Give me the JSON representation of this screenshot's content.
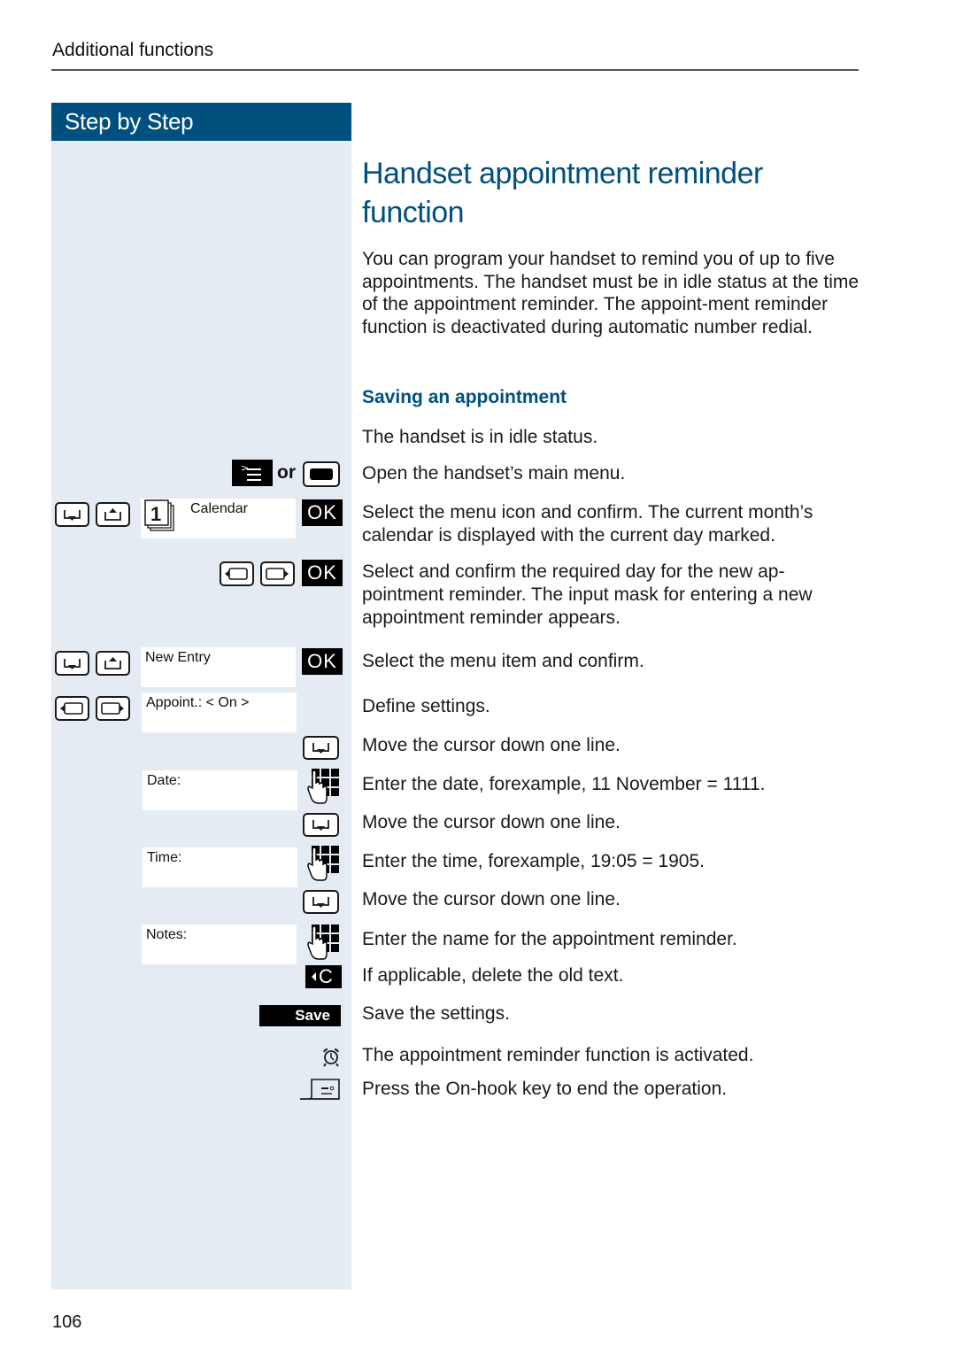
{
  "header": {
    "section": "Additional functions",
    "page_number": "106"
  },
  "sidebar": {
    "title": "Step by Step",
    "or_label": "or",
    "displays": {
      "calendar": "Calendar",
      "calendar_icon_digit": "1",
      "new_entry": "New Entry",
      "appoint": "Appoint.: < On >",
      "date": "Date:",
      "time": "Time:",
      "notes": "Notes:"
    },
    "ok_label": "OK",
    "clear_label": "C",
    "save_label": "Save"
  },
  "main": {
    "title": "Handset appointment reminder function",
    "intro": "You can program your handset to remind you of up to five appointments. The handset must be in idle status at the time of the appointment reminder. The appoint-ment reminder function is deactivated during automatic number redial.",
    "subheading": "Saving an appointment",
    "steps": [
      "The handset is in idle status.",
      "Open the handset’s main menu.",
      "Select the menu icon and confirm. The current month’s calendar is displayed with the current day marked.",
      "Select and confirm the required day for the new ap-pointment reminder. The input mask for entering a new appointment reminder appears.",
      "Select the menu item and confirm.",
      "Define settings.",
      "Move the cursor down one line.",
      "Enter the date, forexample, 11 November = 1111.",
      "Move the cursor down one line.",
      "Enter the time, forexample, 19:05 = 1905.",
      "Move the cursor down one line.",
      "Enter the name for the appointment reminder.",
      "If applicable, delete the old text.",
      "Save the settings.",
      "The appointment reminder function is activated.",
      "Press the On-hook key to end the operation."
    ]
  },
  "colors": {
    "brand_blue": "#00507f",
    "sidebar_bg": "#e4ebf2"
  }
}
